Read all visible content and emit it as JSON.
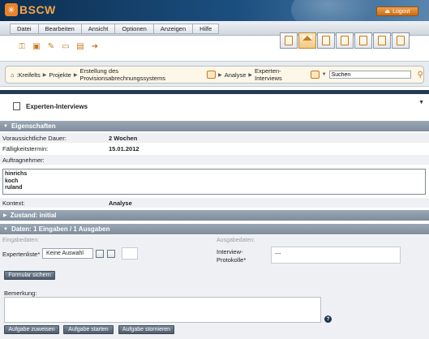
{
  "app": {
    "logo_text": "BSCW",
    "logout_label": "Logout"
  },
  "menu": [
    "Datei",
    "Bearbeiten",
    "Ansicht",
    "Optionen",
    "Anzeigen",
    "Hilfe"
  ],
  "toolbar_icons": [
    "key-icon",
    "open-icon",
    "pencil-icon",
    "folder-icon",
    "new-document-icon",
    "export-icon"
  ],
  "view_icons": [
    "rss-icon",
    "home-icon",
    "clipboard-icon",
    "document-icon",
    "calendar-icon",
    "book-icon",
    "trash-icon"
  ],
  "breadcrumb": {
    "items": [
      ":Kreifelts",
      "Projekte",
      "Erstellung des Provisionsabrechnungssystems",
      "Analyse",
      "Experten-Interviews"
    ],
    "search_value": "Suchen"
  },
  "object": {
    "title": "Experten-Interviews"
  },
  "properties": {
    "heading": "Eigenschaften",
    "duration_label": "Voraussichtliche Dauer:",
    "duration_value": "2 Wochen",
    "due_label": "Fälligkeitstermin:",
    "due_value": "15.01.2012",
    "assignees_label": "Auftragnehmer:",
    "assignees": [
      "hinrichs",
      "koch",
      "ruland"
    ],
    "context_label": "Kontext:",
    "context_value": "Analyse"
  },
  "state": {
    "heading": "Zustand: initial"
  },
  "data": {
    "heading": "Daten: 1 Eingaben / 1 Ausgaben",
    "input_heading": "Eingabedaten:",
    "output_heading": "Ausgabedaten:",
    "expert_list_label": "Expertenliste*",
    "expert_list_value": "Keine Auswahl",
    "output_label_line1": "Interview-",
    "output_label_line2": "Protokolle*",
    "output_value": "---",
    "save_form_label": "Formular sichern"
  },
  "remark": {
    "label": "Bemerkung:"
  },
  "actions": {
    "assign": "Aufgabe zuweisen",
    "start": "Aufgabe starten",
    "cancel": "Aufgabe stornieren"
  }
}
